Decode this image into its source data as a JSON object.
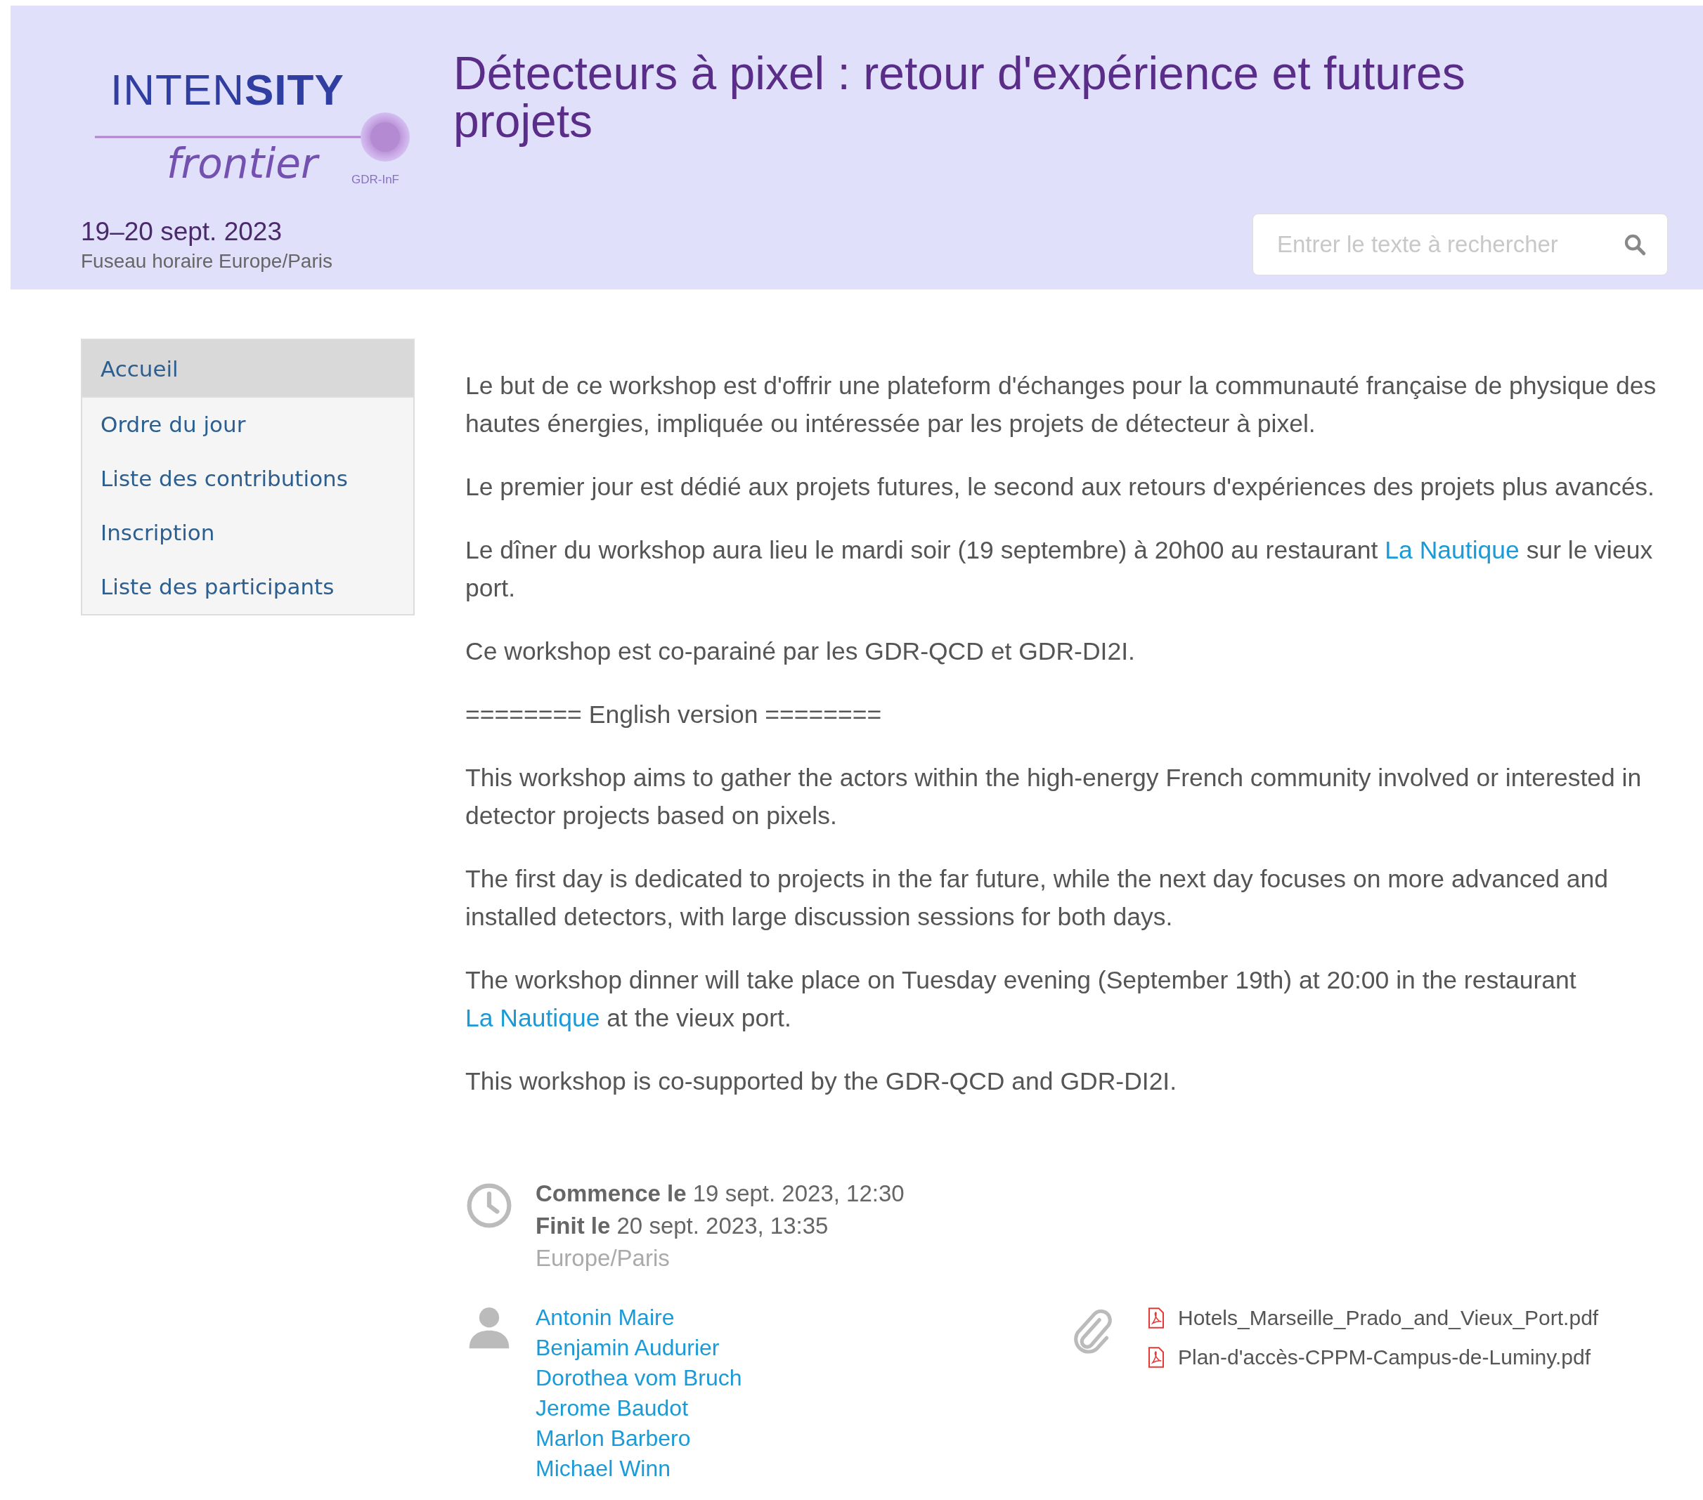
{
  "header": {
    "logo": {
      "wordmark": "INTEN**SITY**",
      "tagline": "frontier",
      "org": "GDR-InF"
    },
    "title": "Détecteurs à pixel : retour d'expérience et futures projets",
    "dates": "19–20 sept. 2023",
    "timezone": "Fuseau horaire Europe/Paris",
    "search": {
      "placeholder": "Entrer le texte à rechercher"
    }
  },
  "menu": [
    {
      "label": "Accueil",
      "selected": true
    },
    {
      "label": "Ordre du jour",
      "selected": false
    },
    {
      "label": "Liste des contributions",
      "selected": false
    },
    {
      "label": "Inscription",
      "selected": false
    },
    {
      "label": "Liste des participants",
      "selected": false
    }
  ],
  "paragraphs": [
    {
      "parts": [
        {
          "kind": "text",
          "text": "Le but de ce workshop est d'offrir une plateform d'échanges pour la communauté française de physique des hautes énergies, impliquée ou intéressée par les projets de détecteur à pixel."
        }
      ]
    },
    {
      "parts": [
        {
          "kind": "text",
          "text": "Le premier jour est dédié aux projets futures, le second aux retours d'expériences des projets plus avancés."
        }
      ]
    },
    {
      "parts": [
        {
          "kind": "text",
          "text": "Le dîner du workshop aura lieu le mardi soir (19 septembre) à 20h00 au restaurant "
        },
        {
          "kind": "link",
          "text": "La Nautique"
        },
        {
          "kind": "text",
          "text": " sur le vieux port."
        }
      ]
    },
    {
      "parts": [
        {
          "kind": "text",
          "text": "Ce workshop est co-parainé par les GDR-QCD et GDR-DI2I."
        }
      ]
    },
    {
      "parts": [
        {
          "kind": "text",
          "text": "======== English version ========"
        }
      ]
    },
    {
      "parts": [
        {
          "kind": "text",
          "text": "This workshop aims to gather the actors within the high-energy French community involved or interested in detector projects based on pixels."
        }
      ]
    },
    {
      "parts": [
        {
          "kind": "text",
          "text": "The first day is dedicated to projects in the far future, while the next day focuses on more advanced and installed detectors, with large discussion sessions for both days."
        }
      ]
    },
    {
      "parts": [
        {
          "kind": "text",
          "text": "The workshop dinner will take place on Tuesday evening (September 19th) at 20:00 in the restaurant "
        },
        {
          "kind": "link",
          "text": "La Nautique"
        },
        {
          "kind": "text",
          "text": " at the vieux port."
        }
      ]
    },
    {
      "parts": [
        {
          "kind": "text",
          "text": "This workshop is co-supported by the GDR-QCD and GDR-DI2I."
        }
      ]
    }
  ],
  "schedule": {
    "starts": "**Commence le** 19 sept. 2023, 12:30",
    "ends": "**Finit le** 20 sept. 2023, 13:35",
    "timezone": "Europe/Paris"
  },
  "organizers": [
    "Antonin Maire",
    "Benjamin Audurier",
    "Dorothea vom Bruch",
    "Jerome Baudot",
    "Marlon Barbero",
    "Michael Winn"
  ],
  "attachments": [
    "Hotels_Marseille_Prado_and_Vieux_Port.pdf",
    "Plan-d'accès-CPPM-Campus-de-Luminy.pdf"
  ]
}
